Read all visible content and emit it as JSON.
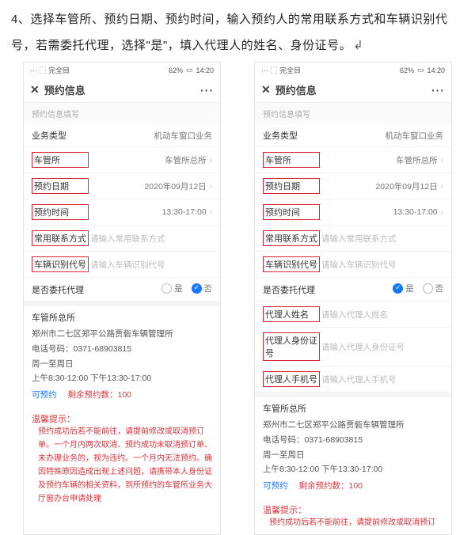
{
  "instruction": "4、选择车管所、预约日期、预约时间，输入预约人的常用联系方式和车辆识别代号，若需委托代理，选择\"是\"，填入代理人的姓名、身份证号。",
  "statusbar": {
    "left": "··· ⬚ 完全目",
    "battery": "62%",
    "time": "14:20"
  },
  "nav": {
    "title": "预约信息",
    "more": "···"
  },
  "section": "预约信息填写",
  "labels": {
    "biztype": "业务类型",
    "office": "车管所",
    "date": "预约日期",
    "time": "预约时间",
    "contact": "常用联系方式",
    "vin": "车辆识别代号",
    "delegate": "是否委托代理",
    "agentName": "代理人姓名",
    "agentId": "代理人身份证号",
    "agentPhone": "代理人手机号"
  },
  "values": {
    "biztype": "机动车窗口业务",
    "office": "车管所总所",
    "date": "2020年09月12日",
    "time": "13:30-17:00"
  },
  "placeholders": {
    "contact": "请输入常用联系方式",
    "vin": "请输入车辆识别代号",
    "agentName": "请输入代理人姓名",
    "agentId": "请输入代理人身份证号",
    "agentPhone": "请输入代理人手机号"
  },
  "radio": {
    "yes": "是",
    "no": "否"
  },
  "officeInfo": {
    "name": "车管所总所",
    "address": "郑州市二七区郑平公路贾砦车辆管理所",
    "phoneLabel": "电话号码：",
    "phone": "0371-68903815",
    "days": "周一至周日",
    "hours": "上午8:30-12:00  下午13:30-17:00",
    "bookable": "可预约",
    "remain": "剩余预约数：100"
  },
  "tips": {
    "title": "温馨提示：",
    "body1": "预约成功后若不能前往，请提前修改或取消预订单。一个月内两次取消、预约成功未取消预订单、未办理业务的，视为违约。一个月内无法预约。确因特殊原因造成出现上述问题，请携带本人身份证及预约车辆的相关资料，到所预约的车管所业务大厅窗办台申请处理",
    "body2": "预约成功后若不能前往，请提前修改或取消预订"
  }
}
